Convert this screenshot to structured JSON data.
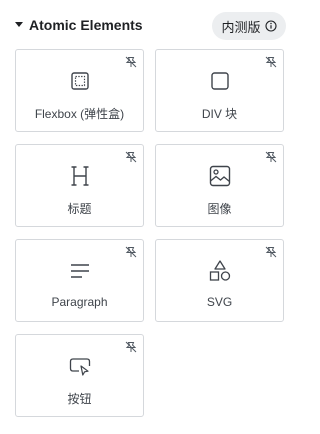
{
  "panel": {
    "title": "Atomic Elements",
    "pro_badge": "内测版",
    "colors": {
      "border": "#d5d8dc",
      "text": "#3f444b",
      "badge_bg": "#eceef0"
    }
  },
  "elements": [
    {
      "label": "Flexbox (弹性盒)",
      "icon": "flexbox-icon"
    },
    {
      "label": "DIV 块",
      "icon": "div-block-icon"
    },
    {
      "label": "标题",
      "icon": "heading-icon"
    },
    {
      "label": "图像",
      "icon": "image-icon"
    },
    {
      "label": "Paragraph",
      "icon": "paragraph-icon"
    },
    {
      "label": "SVG",
      "icon": "svg-shapes-icon"
    },
    {
      "label": "按钮",
      "icon": "button-icon"
    }
  ]
}
